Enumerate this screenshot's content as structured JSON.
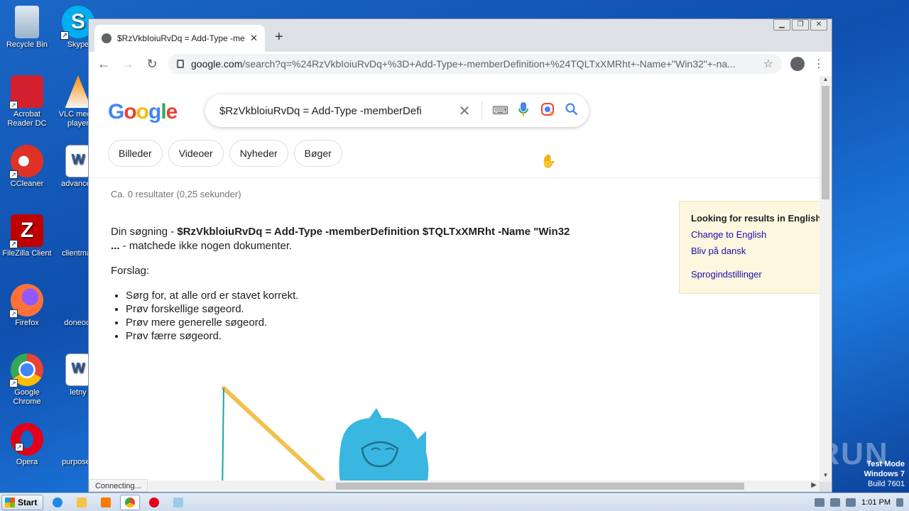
{
  "desktop": {
    "icons": [
      {
        "label": "Recycle Bin"
      },
      {
        "label": "Skype"
      },
      {
        "label": "Acrobat Reader DC"
      },
      {
        "label": "VLC media player"
      },
      {
        "label": "CCleaner"
      },
      {
        "label": "advanced"
      },
      {
        "label": "FileZilla Client"
      },
      {
        "label": "clientmail"
      },
      {
        "label": "Firefox"
      },
      {
        "label": "doneoct"
      },
      {
        "label": "Google Chrome"
      },
      {
        "label": "letny"
      },
      {
        "label": "Opera"
      },
      {
        "label": "purposed"
      }
    ],
    "watermark": "ANY RUN",
    "test_mode": {
      "line1": "Test Mode",
      "line2": "Windows 7",
      "line3": "Build 7601"
    }
  },
  "browser": {
    "tab_title": "$RzVkbIoiuRvDq = Add-Type -memb",
    "url_host": "google.com",
    "url_path": "/search?q=%24RzVkbIoiuRvDq+%3D+Add-Type+-memberDefinition+%24TQLTxXMRht+-Name+\"Win32\"+-na...",
    "status": "Connecting..."
  },
  "google": {
    "logo_letters": [
      "G",
      "o",
      "o",
      "g",
      "l",
      "e"
    ],
    "query": "$RzVkbloiuRvDq = Add-Type -memberDefi",
    "chips": [
      "Billeder",
      "Videoer",
      "Nyheder",
      "Bøger"
    ],
    "stats": "Ca. 0 resultater (0,25 sekunder)",
    "no_results_prefix": "Din søgning - ",
    "no_results_query": "$RzVkbloiuRvDq = Add-Type -memberDefinition $TQLTxXMRht -Name \"Win32 ...",
    "no_results_suffix": " - matchede ikke nogen dokumenter.",
    "suggestions_title": "Forslag:",
    "suggestions": [
      "Sørg for, at alle ord er stavet korrekt.",
      "Prøv forskellige søgeord.",
      "Prøv mere generelle søgeord.",
      "Prøv færre søgeord."
    ],
    "lang_box": {
      "heading": "Looking for results in English",
      "link1": "Change to English",
      "link2": "Bliv på dansk",
      "link3": "Sprogindstillinger"
    }
  },
  "taskbar": {
    "start_label": "Start",
    "clock": "1:01 PM"
  }
}
